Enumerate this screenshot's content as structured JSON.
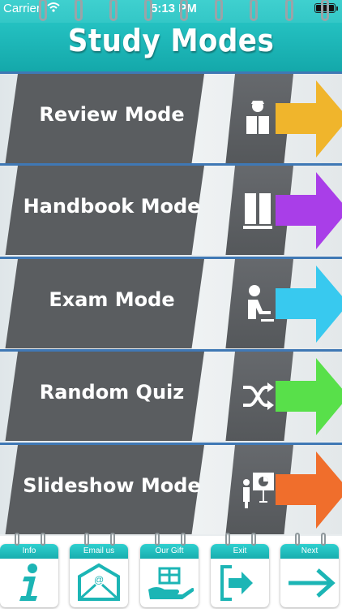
{
  "status_bar": {
    "carrier": "Carrier",
    "time": "5:13 PM"
  },
  "header": {
    "title": "Study Modes"
  },
  "modes": [
    {
      "label": "Review Mode",
      "icon": "reader-icon",
      "arrow_color": "#f0b52c"
    },
    {
      "label": "Handbook Mode",
      "icon": "book-icon",
      "arrow_color": "#a93ee8"
    },
    {
      "label": "Exam Mode",
      "icon": "exam-taker-icon",
      "arrow_color": "#38c9ef"
    },
    {
      "label": "Random Quiz",
      "icon": "shuffle-icon",
      "arrow_color": "#58e04a"
    },
    {
      "label": "Slideshow Mode",
      "icon": "presentation-icon",
      "arrow_color": "#f06e2c"
    }
  ],
  "footer": {
    "tabs": [
      {
        "label": "Info",
        "icon": "info-icon"
      },
      {
        "label": "Email us",
        "icon": "email-icon"
      },
      {
        "label": "Our Gift",
        "icon": "gift-icon"
      },
      {
        "label": "Exit",
        "icon": "exit-icon"
      },
      {
        "label": "Next",
        "icon": "next-arrow-icon"
      }
    ]
  },
  "colors": {
    "accent": "#1cb5b5",
    "slab": "#5a5d60",
    "divider": "#3f78b5"
  }
}
